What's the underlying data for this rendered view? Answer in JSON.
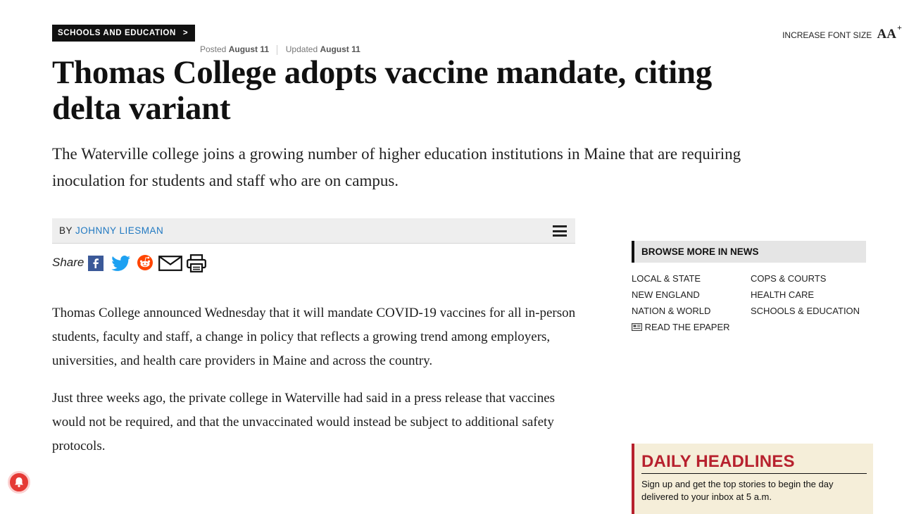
{
  "section_tag": {
    "label": "SCHOOLS AND EDUCATION",
    "chevron": ">"
  },
  "dates": {
    "posted_label": "Posted",
    "posted_value": "August 11",
    "updated_label": "Updated",
    "updated_value": "August 11"
  },
  "font_control": {
    "label": "INCREASE FONT SIZE",
    "icon": "font-size-icon"
  },
  "article": {
    "headline": "Thomas College adopts vaccine mandate, citing delta variant",
    "dek": "The Waterville college joins a growing number of higher education institutions in Maine that are requiring inoculation for students and staff who are on campus.",
    "byline_prefix": "BY",
    "author": "JOHNNY LIESMAN",
    "share_label": "Share",
    "share_icons": [
      "facebook-icon",
      "twitter-icon",
      "reddit-icon",
      "email-icon",
      "print-icon"
    ],
    "paragraphs": [
      "Thomas College announced Wednesday that it will mandate COVID-19 vaccines for all in-person students, faculty and staff, a change in policy that reflects a growing trend among employers, universities, and health care providers in Maine and across the country.",
      "Just three weeks ago, the private college in Waterville had said in a press release that vaccines would not be required, and that the unvaccinated would instead be subject to additional safety protocols."
    ]
  },
  "sidebar": {
    "browse_title": "BROWSE MORE IN NEWS",
    "links_left": [
      "LOCAL & STATE",
      "NEW ENGLAND",
      "NATION & WORLD",
      "READ THE EPAPER"
    ],
    "links_right": [
      "COPS & COURTS",
      "HEALTH CARE",
      "SCHOOLS & EDUCATION"
    ],
    "daily": {
      "title": "DAILY HEADLINES",
      "text": "Sign up and get the top stories to begin the day delivered to your inbox at 5 a.m."
    }
  },
  "colors": {
    "accent_blue": "#1f78c1",
    "headline_red": "#b7212e",
    "daily_bg": "#f5eed9"
  }
}
